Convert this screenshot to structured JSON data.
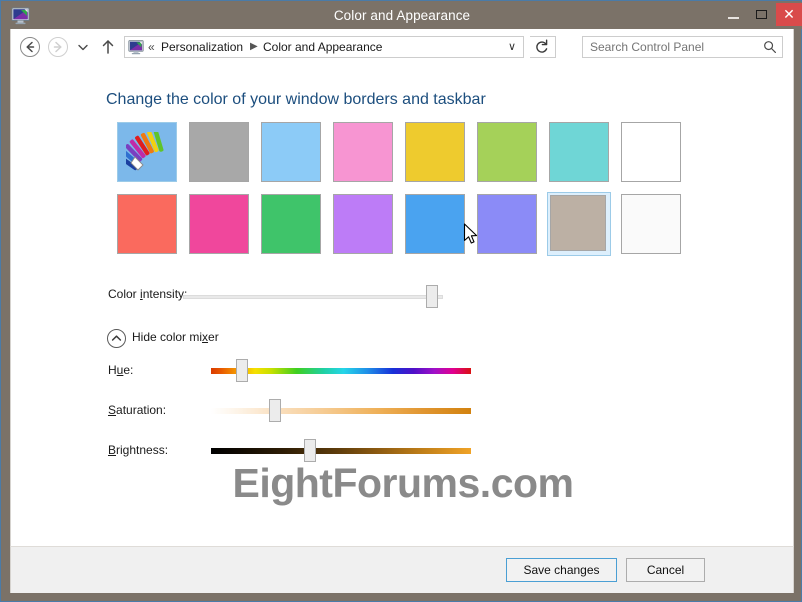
{
  "window": {
    "title": "Color and Appearance",
    "title_icon": "display-personalization-icon",
    "controls": {
      "minimize": "–",
      "maximize": "□",
      "close": "✕"
    }
  },
  "navbar": {
    "back_icon": "back-arrow-icon",
    "forward_icon": "forward-arrow-icon",
    "recent_icon": "chevron-down-icon",
    "up_icon": "up-arrow-icon",
    "address_icon": "display-personalization-icon",
    "chevrons": "«",
    "breadcrumb_1": "Personalization",
    "breadcrumb_separator": "▶",
    "breadcrumb_2": "Color and Appearance",
    "dropdown_icon": "∨",
    "refresh_icon": "refresh-icon",
    "search_placeholder": "Search Control Panel",
    "search_value": "",
    "search_icon": "search-icon"
  },
  "main": {
    "heading": "Change the color of your window borders and taskbar",
    "swatches": [
      {
        "name": "automatic-color-picker",
        "color": "#7cb8ea",
        "auto": true,
        "selected": false
      },
      {
        "name": "swatch-gray",
        "color": "#a8a8a8",
        "auto": false,
        "selected": false
      },
      {
        "name": "swatch-light-blue",
        "color": "#8ccbf7",
        "auto": false,
        "selected": false
      },
      {
        "name": "swatch-pink",
        "color": "#f795d2",
        "auto": false,
        "selected": false
      },
      {
        "name": "swatch-yellow",
        "color": "#eecb2e",
        "auto": false,
        "selected": false
      },
      {
        "name": "swatch-lime",
        "color": "#a5d159",
        "auto": false,
        "selected": false
      },
      {
        "name": "swatch-turquoise",
        "color": "#6fd6d6",
        "auto": false,
        "selected": false
      },
      {
        "name": "swatch-orange",
        "color": "#f9a council",
        "auto": false,
        "selected": false
      },
      {
        "name": "swatch-salmon-red",
        "color": "#fa6a5e",
        "auto": false,
        "selected": false
      },
      {
        "name": "swatch-magenta",
        "color": "#f0479c",
        "auto": false,
        "selected": false
      },
      {
        "name": "swatch-green",
        "color": "#3fc46a",
        "auto": false,
        "selected": false
      },
      {
        "name": "swatch-violet",
        "color": "#bd7cf7",
        "auto": false,
        "selected": false
      },
      {
        "name": "swatch-blue",
        "color": "#4aa3f0",
        "auto": false,
        "selected": false
      },
      {
        "name": "swatch-periwinkle",
        "color": "#8b8bf7",
        "auto": false,
        "selected": false
      },
      {
        "name": "swatch-taupe",
        "color": "#bcb0a4",
        "auto": false,
        "selected": true
      },
      {
        "name": "swatch-white",
        "color": "#fafafa",
        "auto": false,
        "selected": false
      }
    ],
    "intensity": {
      "label": "Color intensity:",
      "accesskey": "i",
      "value_percent": 93
    },
    "mixer_toggle": {
      "label": "Hide color mixer",
      "accesskey": "x",
      "icon": "chevron-up-circle-icon",
      "expanded": true
    },
    "mixer": [
      {
        "name": "hue",
        "label": "Hue:",
        "accesskey": "u",
        "value_percent": 11
      },
      {
        "name": "saturation",
        "label": "Saturation:",
        "accesskey": "S",
        "value_percent": 23
      },
      {
        "name": "brightness",
        "label": "Brightness:",
        "accesskey": "B",
        "value_percent": 36
      }
    ],
    "watermark": "EightForums.com"
  },
  "footer": {
    "save_label": "Save changes",
    "cancel_label": "Cancel"
  },
  "colors": {
    "titlebar": "#7b7268",
    "close_button": "#d94b4b",
    "heading_text": "#1c4e7e",
    "selection_fill": "#ddeffc",
    "selection_border": "#9ccbe8",
    "focus_border": "#4a9fd4",
    "watermark_text": "#8a8a8a",
    "footer_bg": "#f0f0f0"
  }
}
